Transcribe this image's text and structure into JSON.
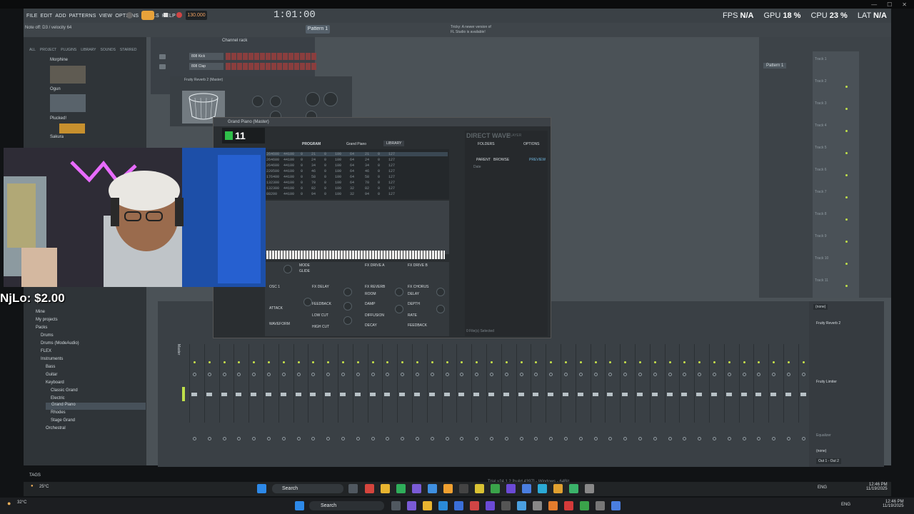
{
  "fl": {
    "menu": [
      "FILE",
      "EDIT",
      "ADD",
      "PATTERNS",
      "VIEW",
      "OPTIONS",
      "TOOLS",
      "HELP"
    ],
    "tempo": "130.000",
    "timer": "1:01:00",
    "pattern": "Pattern 1",
    "hint": "Note off: D3 / velocity 64",
    "news": [
      "Tricky: A newer version of",
      "FL Studio is available!"
    ],
    "stats": {
      "fps_label": "FPS",
      "fps_value": "N/A",
      "gpu_label": "GPU",
      "gpu_value": "18 %",
      "cpu_label": "CPU",
      "cpu_value": "23 %",
      "lat_label": "LAT",
      "lat_value": "N/A"
    },
    "status_bar": "Trial v24.1.2 [build 4397] - Windows - 64Bit"
  },
  "browser": {
    "tabs": [
      "ALL",
      "PROJECT",
      "PLUGINS",
      "LIBRARY",
      "SOUNDS",
      "STARRED"
    ],
    "plugins_top": [
      "Morphine",
      "Ogun",
      "Plucked!",
      "Sakura"
    ],
    "tree": [
      "Mine",
      "My projects",
      "Packs",
      "Drums",
      "Drums (ModeAudio)",
      "FLEX",
      "Instruments",
      "Bass",
      "Guitar",
      "Keyboard",
      "Classic Grand",
      "Electric",
      "Grand Piano",
      "Rhodes",
      "Stage Grand",
      "Orchestral"
    ],
    "selected": "Grand Piano",
    "tags": "TAGS"
  },
  "channel_rack": {
    "title": "Channel rack",
    "channels": [
      "808 Kick",
      "808 Clap"
    ]
  },
  "reverb": {
    "title": "Fruity Reverb 2 (Master)"
  },
  "playlist": {
    "pattern": "Pattern 1",
    "tracks": [
      "Track 1",
      "Track 2",
      "Track 3",
      "Track 4",
      "Track 5",
      "Track 6",
      "Track 7",
      "Track 8",
      "Track 9",
      "Track 10",
      "Track 11"
    ]
  },
  "piano": {
    "title": "Grand Piano (Master)",
    "kompact": "11",
    "tabs": [
      "PROGRAM",
      "LIBRARY"
    ],
    "program": "Grand Piano",
    "plugin": "DIRECT WAVE",
    "plugin_sub": "PLAYER",
    "panel_tabs": [
      "FOLDERS",
      "OPTIONS"
    ],
    "panel_items": [
      "PARENT",
      "BROWSE",
      "PREVIEW"
    ],
    "panel_date": "Date",
    "panel_status": "0 File(s) Selected",
    "rows": [
      "264600  44100   0    21    0    100    64     21    0    127",
      "264600  44100   0    24    0    100    64     24    0    127",
      "264600  44100   0    34    0    100    64     34    0    127",
      "220500  44100   0    46    0    100    64     46    0    127",
      "176400  44100   0    58    0    100    64     58    0    127",
      "132300  44100   0    70    0    100    64     70    0    127",
      "132300  44100   0    82    0    100    32     82    0    127",
      "88200   44100   0    94    0    100    32     94    0    127"
    ],
    "fx": [
      "MODE",
      "GLIDE",
      "FX DRIVE A",
      "FX DRIVE B",
      "OSC 1",
      "FX DELAY",
      "FX REVERB",
      "FX CHORUS",
      "ATTACK",
      "FEEDBACK",
      "ROOM",
      "DELAY",
      "WAVEFORM",
      "LOW CUT",
      "DAMP",
      "DEPTH",
      "DIFFUSION",
      "RATE",
      "DECAY",
      "HIGH CUT",
      "FEEDBACK"
    ]
  },
  "overlay": {
    "donation": "NjLo: $2.00"
  },
  "mixer": {
    "master": "Master",
    "right_title": "Fruity Reverb 2",
    "limiter": "Fruity Limiter",
    "equalizer": "Equalizer",
    "out": "Out 1 - Out 2",
    "none": "(none)"
  },
  "inner_taskbar": {
    "weather": "25°C",
    "search": "Search",
    "time": "12:46 PM",
    "date": "11/19/2025",
    "lang": "ENG"
  },
  "taskbar": {
    "weather": "32°C",
    "search": "Search",
    "time": "12:46 PM",
    "date": "11/19/2025",
    "lang": "ENG"
  }
}
